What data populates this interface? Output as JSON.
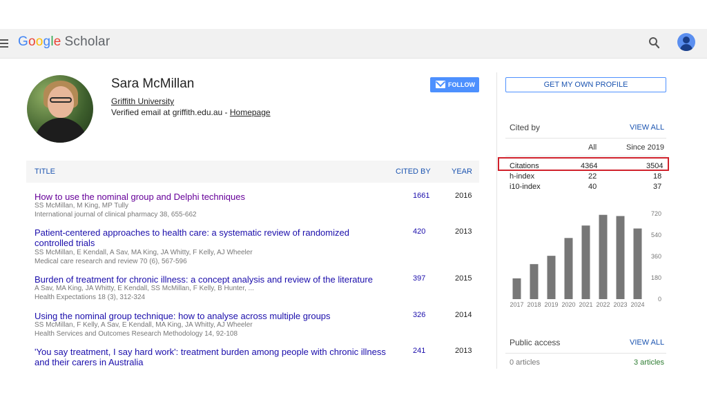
{
  "app": {
    "logo_parts": [
      "G",
      "o",
      "o",
      "g",
      "l",
      "e"
    ],
    "logo_product": "Scholar"
  },
  "icons": {
    "menu": "hamburger-menu-icon",
    "search": "search-icon",
    "account": "account-avatar-icon",
    "follow": "envelope-icon"
  },
  "colors": {
    "link": "#1a0dab",
    "visited": "#660099",
    "accent": "#4d90fe",
    "bar": "#777777",
    "highlight": "#d0202a",
    "open_access": "#2e7d32"
  },
  "profile": {
    "name": "Sara McMillan",
    "affiliation": "Griffith University",
    "email_text": "Verified email at griffith.edu.au - ",
    "homepage_label": "Homepage",
    "follow_label": "FOLLOW"
  },
  "table": {
    "headers": {
      "title": "TITLE",
      "cited_by": "CITED BY",
      "year": "YEAR"
    },
    "rows": [
      {
        "title": "How to use the nominal group and Delphi techniques",
        "authors": "SS McMillan, M King, MP Tully",
        "venue": "International journal of clinical pharmacy 38, 655-662",
        "cited_by": "1661",
        "year": "2016",
        "visited": true
      },
      {
        "title": "Patient-centered approaches to health care: a systematic review of randomized controlled trials",
        "authors": "SS McMillan, E Kendall, A Sav, MA King, JA Whitty, F Kelly, AJ Wheeler",
        "venue": "Medical care research and review 70 (6), 567-596",
        "cited_by": "420",
        "year": "2013",
        "visited": false
      },
      {
        "title": "Burden of treatment for chronic illness: a concept analysis and review of the literature",
        "authors": "A Sav, MA King, JA Whitty, E Kendall, SS McMillan, F Kelly, B Hunter, ...",
        "venue": "Health Expectations 18 (3), 312-324",
        "cited_by": "397",
        "year": "2015",
        "visited": false
      },
      {
        "title": "Using the nominal group technique: how to analyse across multiple groups",
        "authors": "SS McMillan, F Kelly, A Sav, E Kendall, MA King, JA Whitty, AJ Wheeler",
        "venue": "Health Services and Outcomes Research Methodology 14, 92-108",
        "cited_by": "326",
        "year": "2014",
        "visited": false
      },
      {
        "title": "'You say treatment, I say hard work': treatment burden among people with chronic illness and their carers in Australia",
        "authors": "",
        "venue": "",
        "cited_by": "241",
        "year": "2013",
        "visited": false
      }
    ]
  },
  "sidebar": {
    "get_profile_label": "GET MY OWN PROFILE",
    "cited_by_label": "Cited by",
    "view_all_label": "VIEW ALL",
    "col_all": "All",
    "col_since": "Since 2019",
    "metrics": [
      {
        "label": "Citations",
        "all": "4364",
        "since": "3504"
      },
      {
        "label": "h-index",
        "all": "22",
        "since": "18"
      },
      {
        "label": "i10-index",
        "all": "40",
        "since": "37"
      }
    ],
    "public_access_label": "Public access",
    "public_access_view_all": "VIEW ALL",
    "not_available": "0 articles",
    "available": "3 articles"
  },
  "chart_data": {
    "type": "bar",
    "categories": [
      "2017",
      "2018",
      "2019",
      "2020",
      "2021",
      "2022",
      "2023",
      "2024"
    ],
    "values": [
      175,
      295,
      365,
      515,
      620,
      710,
      700,
      595
    ],
    "yticks": [
      "0",
      "180",
      "360",
      "540",
      "720"
    ],
    "ylim": [
      0,
      720
    ],
    "grid": false
  }
}
